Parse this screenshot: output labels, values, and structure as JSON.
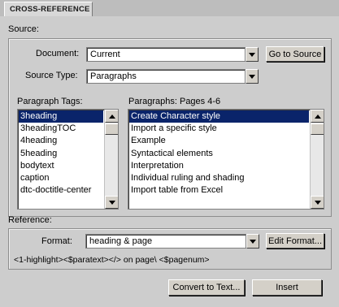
{
  "tab": {
    "label": "CROSS-REFERENCE"
  },
  "source": {
    "heading": "Source:",
    "document_label": "Document:",
    "document_value": "Current",
    "go_to_source": "Go to Source",
    "source_type_label": "Source Type:",
    "source_type_value": "Paragraphs",
    "paragraph_tags_label": "Paragraph Tags:",
    "paragraphs_label": "Paragraphs: Pages  4-6",
    "tags": [
      "3heading",
      "3headingTOC",
      "4heading",
      "5heading",
      "bodytext",
      "caption",
      "dtc-doctitle-center"
    ],
    "paragraphs": [
      "Create Character style",
      "Import a specific style",
      "Example",
      "Syntactical elements",
      "Interpretation",
      "Individual ruling and shading",
      "Import table from Excel"
    ]
  },
  "reference": {
    "heading": "Reference:",
    "format_label": "Format:",
    "format_value": "heading & page",
    "edit_format": "Edit Format...",
    "format_code": "<1-highlight><$paratext></> on page\\ <$pagenum>"
  },
  "buttons": {
    "convert": "Convert to Text...",
    "insert": "Insert"
  }
}
